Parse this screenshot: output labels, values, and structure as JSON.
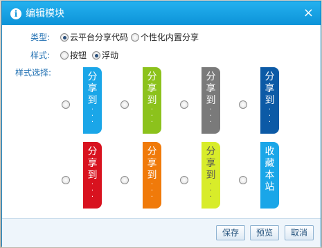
{
  "dialog": {
    "title": "编辑模块",
    "close": "×"
  },
  "type": {
    "label": "类型:",
    "options": [
      {
        "label": "云平台分享代码",
        "checked": true
      },
      {
        "label": "个性化内置分享",
        "checked": false
      }
    ]
  },
  "style": {
    "label": "样式:",
    "options": [
      {
        "label": "按钮",
        "checked": false
      },
      {
        "label": "浮动",
        "checked": true
      }
    ]
  },
  "style_select": {
    "label": "样式选择:",
    "items": [
      {
        "text": "分享到",
        "dots": true,
        "color": "#1aa6e8"
      },
      {
        "text": "分享到",
        "dots": true,
        "color": "#8cc21c"
      },
      {
        "text": "分享到",
        "dots": true,
        "color": "#7a7a7a"
      },
      {
        "text": "分享到",
        "dots": true,
        "color": "#0c5aa6"
      },
      {
        "text": "分享到",
        "dots": true,
        "color": "#d8121f"
      },
      {
        "text": "分享到",
        "dots": true,
        "color": "#f07a0a"
      },
      {
        "text": "分享到",
        "dots": true,
        "color": "#d8ec2a",
        "text_color": "#555555"
      },
      {
        "text": "收藏本站",
        "dots": false,
        "color": "#1aa6e8"
      }
    ]
  },
  "footer": {
    "save": "保存",
    "preview": "预览",
    "cancel": "取消"
  }
}
